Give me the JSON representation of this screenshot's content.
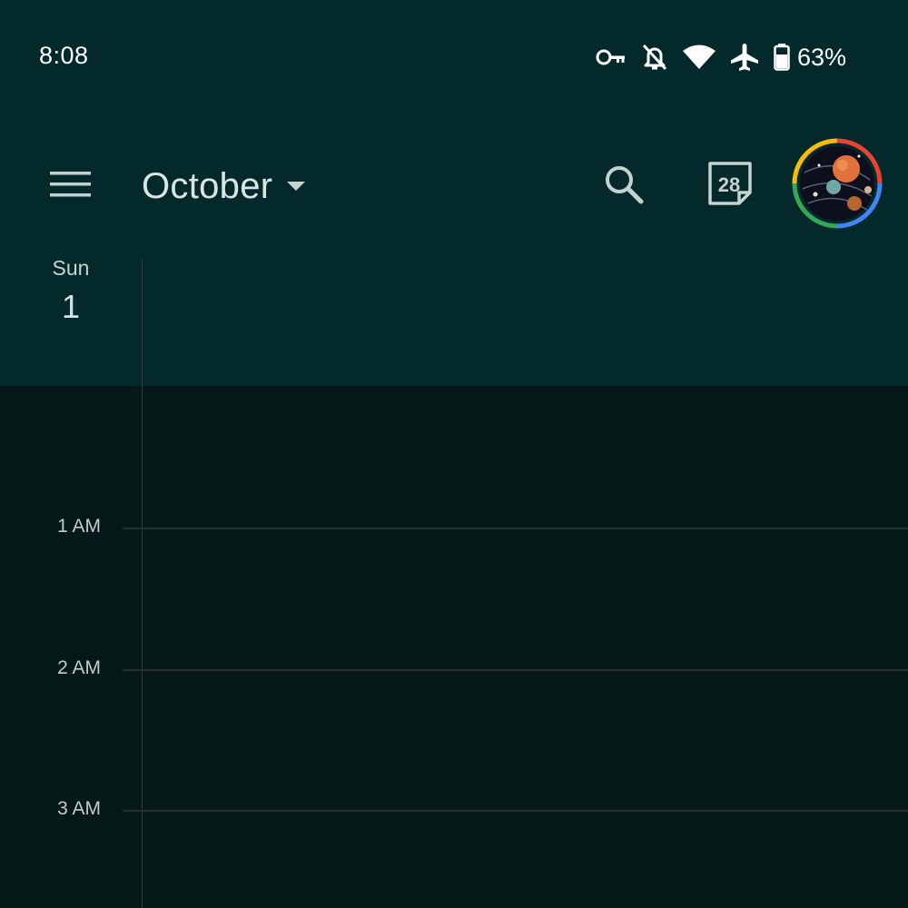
{
  "status_bar": {
    "time": "8:08",
    "battery_percent": "63%",
    "icons": [
      "vpn-key-icon",
      "notifications-off-icon",
      "wifi-icon",
      "airplane-mode-icon",
      "battery-icon"
    ]
  },
  "app_bar": {
    "menu_icon": "menu-icon",
    "month": "October",
    "dropdown_icon": "arrow-drop-down-icon",
    "search_icon": "search-icon",
    "today_date": "28",
    "avatar_icon": "account-avatar"
  },
  "day_header": {
    "day_of_week": "Sun",
    "day_number": "1"
  },
  "hours": [
    {
      "label": "1 AM"
    },
    {
      "label": "2 AM"
    },
    {
      "label": "3 AM"
    }
  ],
  "colors": {
    "header_bg": "#03292a",
    "body_bg": "#061817",
    "grid_line": "#24312f"
  }
}
